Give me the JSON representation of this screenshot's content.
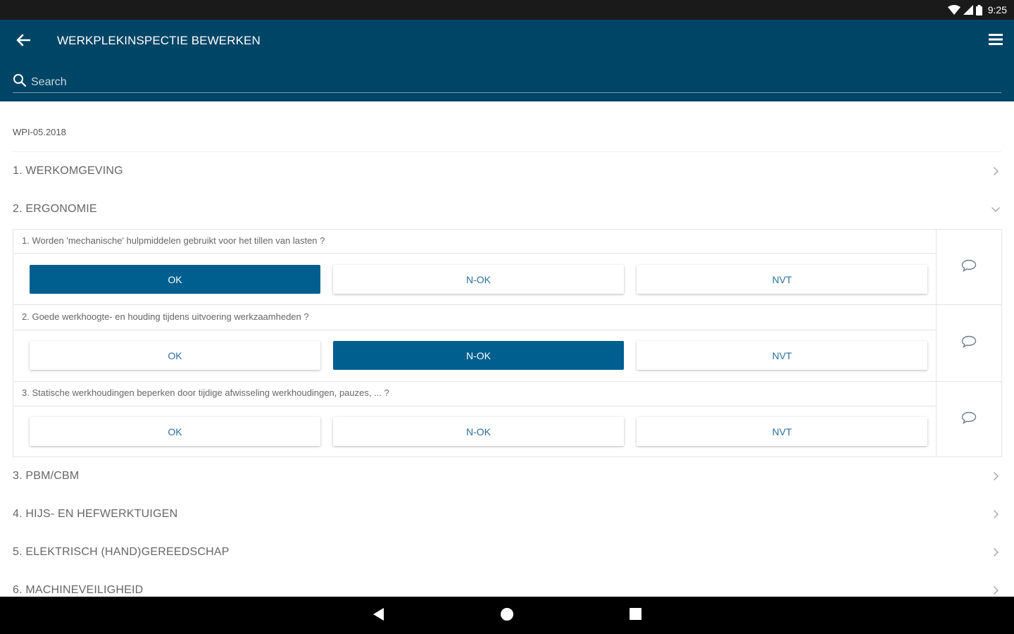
{
  "status_bar": {
    "time": "9:25",
    "icons": [
      "wifi-icon",
      "signal-icon",
      "battery-icon"
    ]
  },
  "app_bar": {
    "title": "WERKPLEKINSPECTIE BEWERKEN",
    "search_placeholder": "Search",
    "back_icon": "arrow-left-icon",
    "menu_icon": "hamburger-menu-icon"
  },
  "document": {
    "code": "WPI-05.2018"
  },
  "sections": [
    {
      "label": "1. WERKOMGEVING",
      "state": "collapsed"
    },
    {
      "label": "2. ERGONOMIE",
      "state": "expanded"
    },
    {
      "label": "3. PBM/CBM",
      "state": "collapsed"
    },
    {
      "label": "4. HIJS- EN HEFWERKTUIGEN",
      "state": "collapsed"
    },
    {
      "label": "5. ELEKTRISCH (HAND)GEREEDSCHAP",
      "state": "collapsed"
    },
    {
      "label": "6. MACHINEVEILIGHEID",
      "state": "collapsed"
    }
  ],
  "questions": [
    {
      "text": "1. Worden 'mechanische' hulpmiddelen gebruikt voor het tillen van lasten ?",
      "options": [
        "OK",
        "N-OK",
        "NVT"
      ],
      "selected": "OK"
    },
    {
      "text": "2. Goede werkhoogte- en houding tijdens uitvoering werkzaamheden ?",
      "options": [
        "OK",
        "N-OK",
        "NVT"
      ],
      "selected": "N-OK"
    },
    {
      "text": "3. Statische werkhoudingen beperken door tijdige afwisseling werkhoudingen, pauzes, ... ?",
      "options": [
        "OK",
        "N-OK",
        "NVT"
      ],
      "selected": null
    }
  ],
  "colors": {
    "app_bar": "#004566",
    "selected_button": "#005f8e",
    "button_text": "#2a6f9b"
  }
}
